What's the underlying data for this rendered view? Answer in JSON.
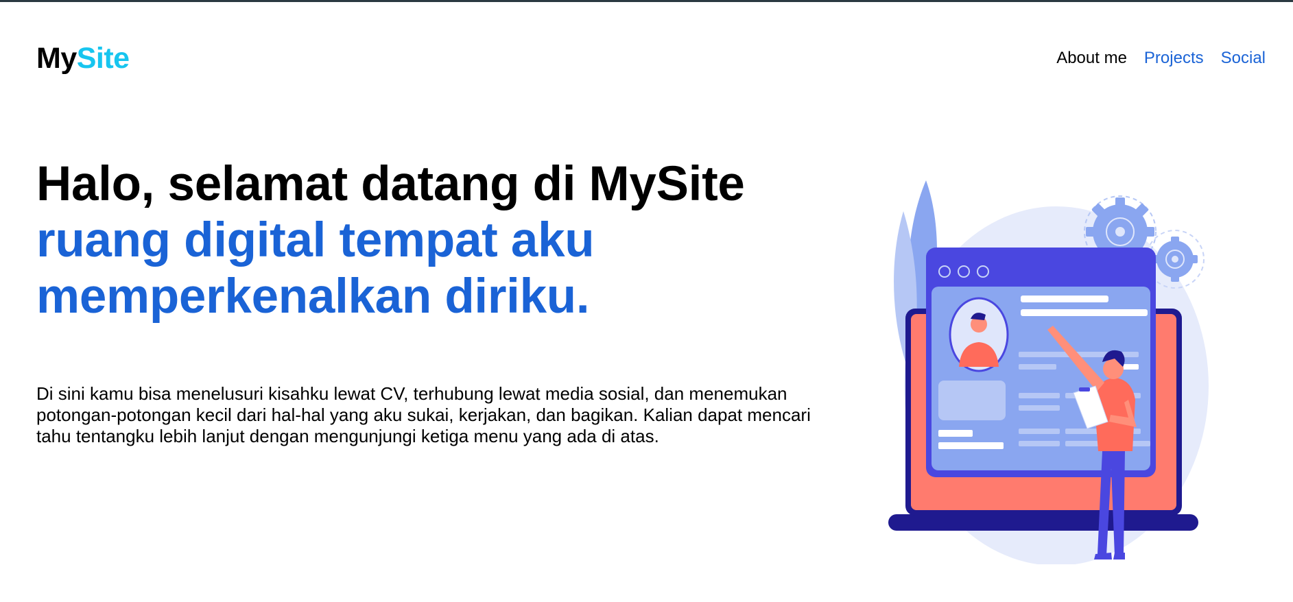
{
  "brand": {
    "part1": "My",
    "part2": "Site"
  },
  "nav": {
    "items": [
      {
        "label": "About me"
      },
      {
        "label": "Projects"
      },
      {
        "label": "Social"
      }
    ]
  },
  "hero": {
    "title_line1": "Halo, selamat datang di MySite",
    "title_line2": "ruang digital tempat aku memperkenalkan diriku.",
    "description": "Di sini kamu bisa menelusuri kisahku lewat CV, terhubung lewat media sosial, dan menemukan potongan-potongan kecil dari hal-hal yang aku sukai, kerjakan, dan bagikan. Kalian dapat mencari tahu tentangku lebih lanjut dengan mengunjungi ketiga menu yang ada di atas."
  },
  "colors": {
    "accent_blue": "#1a63d6",
    "brand_cyan": "#17c5ef",
    "illustration_navy": "#1f1a8f",
    "illustration_coral": "#ff7b6e",
    "illustration_periwinkle": "#8aa6f0"
  },
  "icons": {
    "illustration": "developer-profile-illustration"
  }
}
